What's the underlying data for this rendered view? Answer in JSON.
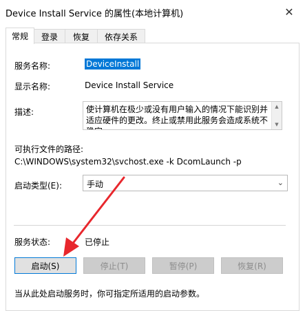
{
  "window": {
    "title": "Device Install Service 的属性(本地计算机)",
    "close_glyph": "✕"
  },
  "tabs": [
    {
      "label": "常规",
      "active": true
    },
    {
      "label": "登录",
      "active": false
    },
    {
      "label": "恢复",
      "active": false
    },
    {
      "label": "依存关系",
      "active": false
    }
  ],
  "general": {
    "service_name_label": "服务名称:",
    "service_name_value": "DeviceInstall",
    "display_name_label": "显示名称:",
    "display_name_value": "Device Install Service",
    "description_label": "描述:",
    "description_value": "使计算机在极少或没有用户输入的情况下能识别并适应硬件的更改。终止或禁用此服务会造成系统不稳定。",
    "exe_path_label": "可执行文件的路径:",
    "exe_path_value": "C:\\WINDOWS\\system32\\svchost.exe -k DcomLaunch -p",
    "startup_type_label": "启动类型(E):",
    "startup_type_value": "手动",
    "status_label": "服务状态:",
    "status_value": "已停止",
    "hint": "当从此处启动服务时，你可指定所适用的启动参数。"
  },
  "buttons": {
    "start": "启动(S)",
    "stop": "停止(T)",
    "pause": "暂停(P)",
    "resume": "恢复(R)"
  },
  "colors": {
    "annotation_arrow": "#e8272d",
    "selection": "#0078d7"
  },
  "icons": {
    "close": "close-icon",
    "dropdown": "chevron-down-icon",
    "scroll_up": "scroll-up-icon",
    "scroll_down": "scroll-down-icon"
  }
}
